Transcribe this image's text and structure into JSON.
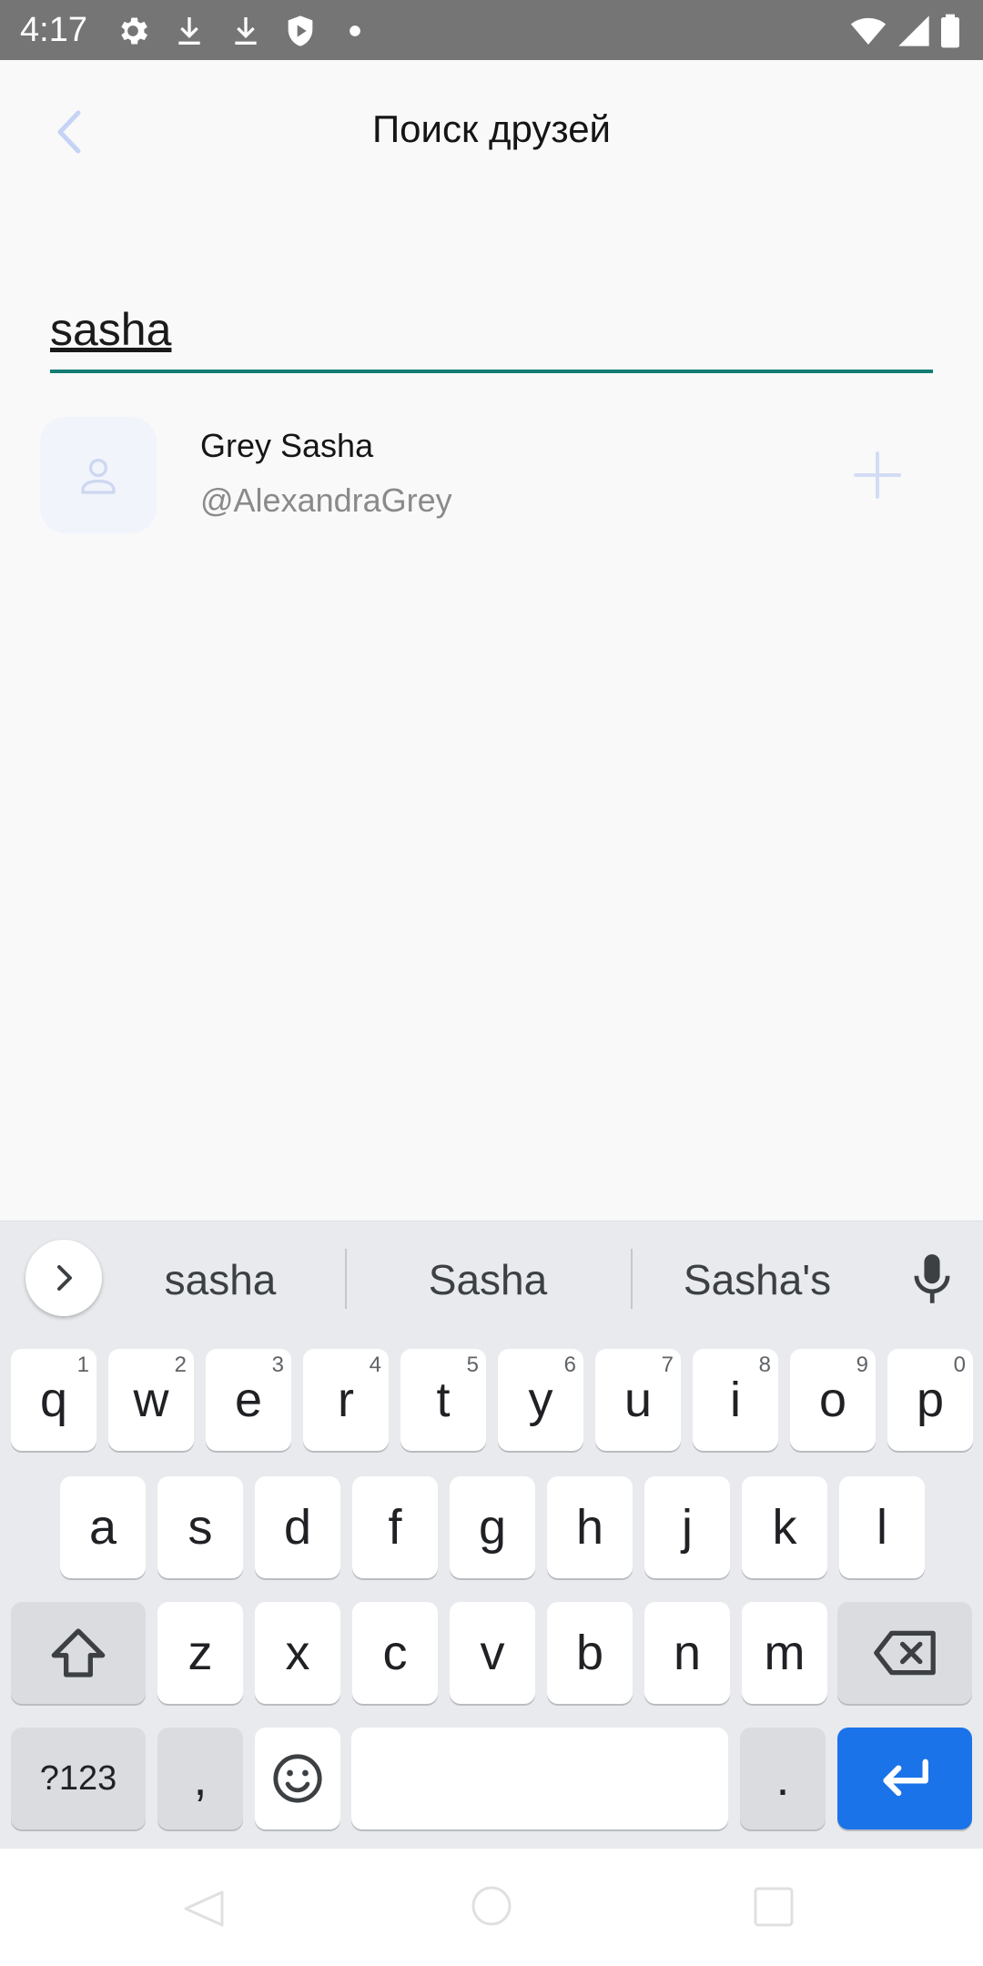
{
  "status_bar": {
    "time": "4:17",
    "left_icons": [
      "gear-icon",
      "download-icon",
      "download-icon",
      "shield-icon",
      "dot-icon"
    ],
    "right_icons": [
      "wifi-icon",
      "cell-signal-icon",
      "battery-icon"
    ]
  },
  "header": {
    "back_icon": "chevron-left-icon",
    "title": "Поиск друзей"
  },
  "search": {
    "value": "sasha"
  },
  "results": [
    {
      "name": "Grey Sasha",
      "username": "@AlexandraGrey",
      "avatar_icon": "person-icon",
      "action_icon": "plus-icon"
    }
  ],
  "keyboard": {
    "suggestions": [
      "sasha",
      "Sasha",
      "Sasha's"
    ],
    "row1": [
      {
        "key": "q",
        "hint": "1"
      },
      {
        "key": "w",
        "hint": "2"
      },
      {
        "key": "e",
        "hint": "3"
      },
      {
        "key": "r",
        "hint": "4"
      },
      {
        "key": "t",
        "hint": "5"
      },
      {
        "key": "y",
        "hint": "6"
      },
      {
        "key": "u",
        "hint": "7"
      },
      {
        "key": "i",
        "hint": "8"
      },
      {
        "key": "o",
        "hint": "9"
      },
      {
        "key": "p",
        "hint": "0"
      }
    ],
    "row2": [
      "a",
      "s",
      "d",
      "f",
      "g",
      "h",
      "j",
      "k",
      "l"
    ],
    "row3": [
      "z",
      "x",
      "c",
      "v",
      "b",
      "n",
      "m"
    ],
    "symbols_label": "?123",
    "comma_label": ",",
    "period_label": ".",
    "colors": {
      "enter": "#1a73e8",
      "accent": "#127d72"
    }
  }
}
